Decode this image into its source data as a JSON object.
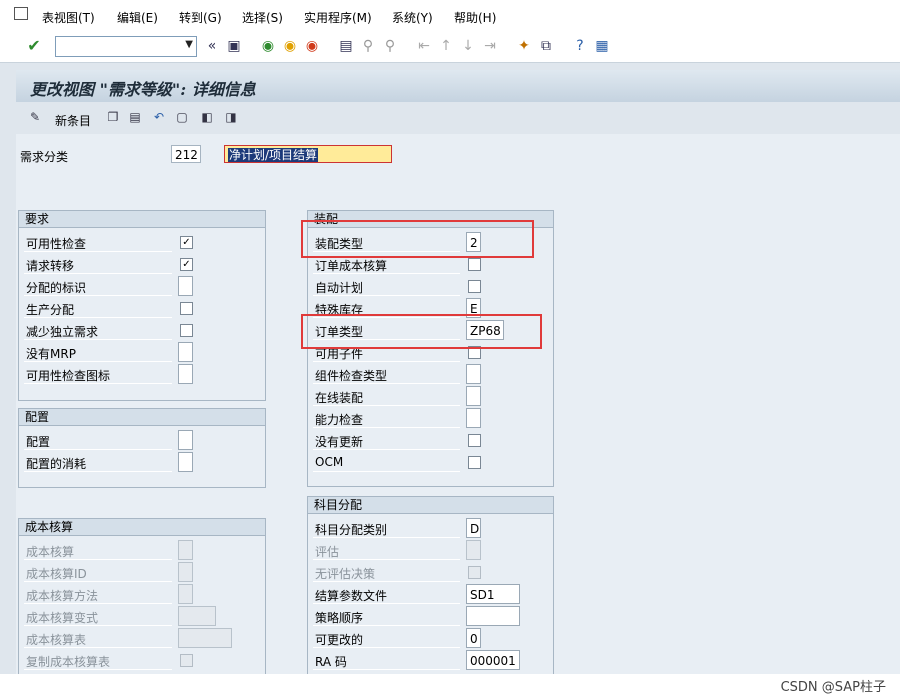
{
  "menu": [
    "表视图(T)",
    "编辑(E)",
    "转到(G)",
    "选择(S)",
    "实用程序(M)",
    "系统(Y)",
    "帮助(H)"
  ],
  "toolbar": {
    "command_value": "",
    "icons": [
      "enter-icon",
      "back-icon",
      "exit-icon",
      "cancel-icon",
      "print-icon",
      "find-icon",
      "find-next-icon",
      "first-page-icon",
      "prev-page-icon",
      "next-page-icon",
      "last-page-icon",
      "create-session-icon",
      "shortcut-icon",
      "help-icon",
      "layout-icon"
    ]
  },
  "title": "更改视图 \"需求等级\": 详细信息",
  "app_toolbar": {
    "new_entries": "新条目"
  },
  "header": {
    "label": "需求分类",
    "code": "212",
    "description": "净计划/项目结算"
  },
  "groups": {
    "requirements": {
      "title": "要求",
      "rows": [
        {
          "label": "可用性检查",
          "type": "check",
          "value": "✓"
        },
        {
          "label": "请求转移",
          "type": "check",
          "value": "✓"
        },
        {
          "label": "分配的标识",
          "type": "field",
          "value": ""
        },
        {
          "label": "生产分配",
          "type": "check",
          "value": ""
        },
        {
          "label": "减少独立需求",
          "type": "check",
          "value": ""
        },
        {
          "label": "没有MRP",
          "type": "field",
          "value": ""
        },
        {
          "label": "可用性检查图标",
          "type": "field",
          "value": ""
        }
      ]
    },
    "config": {
      "title": "配置",
      "rows": [
        {
          "label": "配置",
          "type": "field",
          "value": ""
        },
        {
          "label": "配置的消耗",
          "type": "field",
          "value": ""
        }
      ]
    },
    "costing": {
      "title": "成本核算",
      "rows": [
        {
          "label": "成本核算",
          "type": "field",
          "value": ""
        },
        {
          "label": "成本核算ID",
          "type": "field",
          "value": ""
        },
        {
          "label": "成本核算方法",
          "type": "field",
          "value": ""
        },
        {
          "label": "成本核算变式",
          "type": "wide",
          "value": ""
        },
        {
          "label": "成本核算表",
          "type": "wider",
          "value": ""
        },
        {
          "label": "复制成本核算表",
          "type": "check",
          "value": ""
        }
      ]
    },
    "assembly": {
      "title": "装配",
      "rows": [
        {
          "label": "装配类型",
          "type": "field",
          "value": "2"
        },
        {
          "label": "订单成本核算",
          "type": "check",
          "value": ""
        },
        {
          "label": "自动计划",
          "type": "check",
          "value": ""
        },
        {
          "label": "特殊库存",
          "type": "field",
          "value": "E"
        },
        {
          "label": "订单类型",
          "type": "wide",
          "value": "ZP68"
        },
        {
          "label": "可用子件",
          "type": "check",
          "value": ""
        },
        {
          "label": "组件检查类型",
          "type": "field",
          "value": ""
        },
        {
          "label": "在线装配",
          "type": "field",
          "value": ""
        },
        {
          "label": "能力检查",
          "type": "field",
          "value": ""
        },
        {
          "label": "没有更新",
          "type": "check",
          "value": ""
        },
        {
          "label": "OCM",
          "type": "check",
          "value": ""
        }
      ]
    },
    "account": {
      "title": "科目分配",
      "rows": [
        {
          "label": "科目分配类别",
          "type": "field",
          "value": "D"
        },
        {
          "label": "评估",
          "type": "field",
          "value": ""
        },
        {
          "label": "无评估决策",
          "type": "check",
          "value": ""
        },
        {
          "label": "结算参数文件",
          "type": "wider",
          "value": "SD1"
        },
        {
          "label": "策略顺序",
          "type": "wider",
          "value": ""
        },
        {
          "label": "可更改的",
          "type": "field",
          "value": "0"
        },
        {
          "label": "RA 码",
          "type": "wider",
          "value": "000001"
        }
      ]
    }
  },
  "watermark": "CSDN @SAP柱子",
  "colors": {
    "highlight": "#e03a3a",
    "input_highlight": "#ffeb99"
  }
}
